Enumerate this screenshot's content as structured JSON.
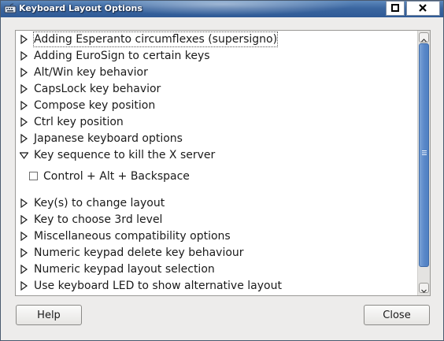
{
  "window": {
    "title": "Keyboard Layout Options",
    "icon": "keyboard-icon"
  },
  "options": [
    {
      "label": "Adding Esperanto circumflexes (supersigno)",
      "expanded": false,
      "selected": true
    },
    {
      "label": "Adding EuroSign to certain keys",
      "expanded": false
    },
    {
      "label": "Alt/Win key behavior",
      "expanded": false
    },
    {
      "label": "CapsLock key behavior",
      "expanded": false
    },
    {
      "label": "Compose key position",
      "expanded": false
    },
    {
      "label": "Ctrl key position",
      "expanded": false
    },
    {
      "label": "Japanese keyboard options",
      "expanded": false
    },
    {
      "label": "Key sequence to kill the X server",
      "expanded": true,
      "children": [
        {
          "label": "Control + Alt + Backspace",
          "checked": false
        }
      ]
    },
    {
      "label": "Key(s) to change layout",
      "expanded": false
    },
    {
      "label": "Key to choose 3rd level",
      "expanded": false
    },
    {
      "label": "Miscellaneous compatibility options",
      "expanded": false
    },
    {
      "label": "Numeric keypad delete key behaviour",
      "expanded": false
    },
    {
      "label": "Numeric keypad layout selection",
      "expanded": false
    },
    {
      "label": "Use keyboard LED to show alternative layout",
      "expanded": false
    }
  ],
  "buttons": {
    "help": "Help",
    "close": "Close"
  },
  "colors": {
    "titlebar": "#3b66a0",
    "scroll_thumb": "#5b89c9"
  }
}
